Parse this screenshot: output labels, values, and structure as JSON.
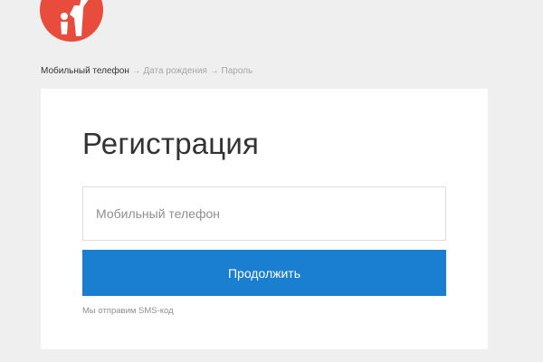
{
  "logo": {
    "icon": "figure-logo-icon",
    "color": "#e84c3d"
  },
  "steps": {
    "current": "Мобильный телефон",
    "separator": "→",
    "second": "Дата рождения",
    "third": "Пароль"
  },
  "form": {
    "title": "Регистрация",
    "phone_placeholder": "Мобильный телефон",
    "phone_value": "",
    "continue_label": "Продолжить",
    "sms_note": "Мы отправим SMS-код"
  },
  "colors": {
    "accent": "#1a7fd0",
    "background": "#efefef",
    "card": "#ffffff"
  }
}
